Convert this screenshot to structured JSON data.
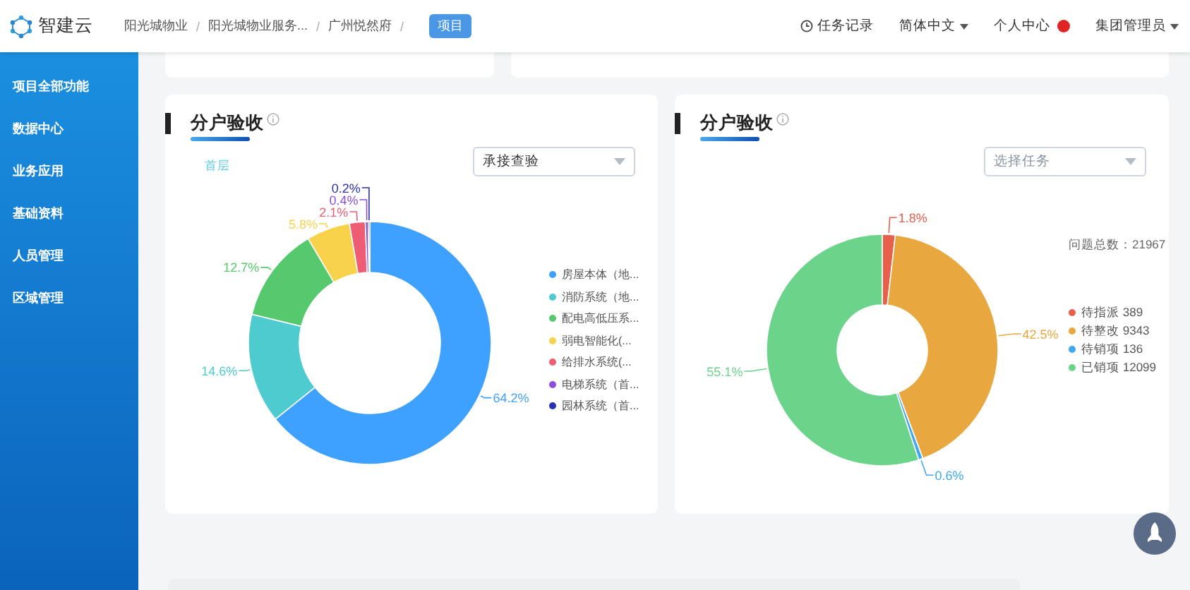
{
  "header": {
    "logo_text": "智建云",
    "breadcrumbs": [
      {
        "label": "阳光城物业",
        "separator": "/"
      },
      {
        "label": "阳光城物业服务...",
        "separator": "/"
      },
      {
        "label": "广州悦然府",
        "separator": "/"
      }
    ],
    "badge": "项目",
    "menu": [
      {
        "kind": "tasks",
        "label": "任务记录"
      },
      {
        "kind": "dropdown",
        "label": "简体中文"
      },
      {
        "kind": "alert",
        "label": "个人中心"
      },
      {
        "kind": "dropdown",
        "label": "集团管理员"
      }
    ]
  },
  "sidebar": {
    "items": [
      "项目全部功能",
      "数据中心",
      "业务应用",
      "基础资料",
      "人员管理",
      "区域管理"
    ]
  },
  "panels": [
    {
      "title": "分户验收",
      "floor_tab": "首层",
      "select": {
        "value": "承接查验"
      },
      "chart_data": {
        "type": "donut",
        "categories": [
          "房屋本体（地...",
          "消防系统（地...",
          "配电高低压系...",
          "弱电智能化(...",
          "给排水系统(...",
          "电梯系统（首...",
          "园林系统（首..."
        ],
        "values": [
          64.2,
          14.6,
          12.7,
          5.8,
          2.1,
          0.4,
          0.2
        ],
        "colors": [
          "#3fa1ff",
          "#4ecbcf",
          "#56c96f",
          "#f8d24b",
          "#ef5d75",
          "#8c4fdd",
          "#2a30b4"
        ],
        "value_labels": [
          "64.2%",
          "14.6%",
          "12.7%",
          "5.8%",
          "2.1%",
          "0.4%",
          "0.2%"
        ],
        "legend": "right"
      }
    },
    {
      "title": "分户验收",
      "select": {
        "placeholder": "选择任务"
      },
      "total": "问题总数：21967",
      "chart_data": {
        "type": "donut",
        "categories": [
          "待指派 389",
          "待整改 9343",
          "待销项 136",
          "已销项 12099"
        ],
        "values": [
          1.8,
          42.5,
          0.6,
          55.1
        ],
        "colors": [
          "#e8604b",
          "#e9a73f",
          "#41a8ef",
          "#6cd38b"
        ],
        "value_labels": [
          "1.8%",
          "42.5%",
          "0.6%",
          "55.1%"
        ],
        "legend": "right"
      }
    }
  ]
}
